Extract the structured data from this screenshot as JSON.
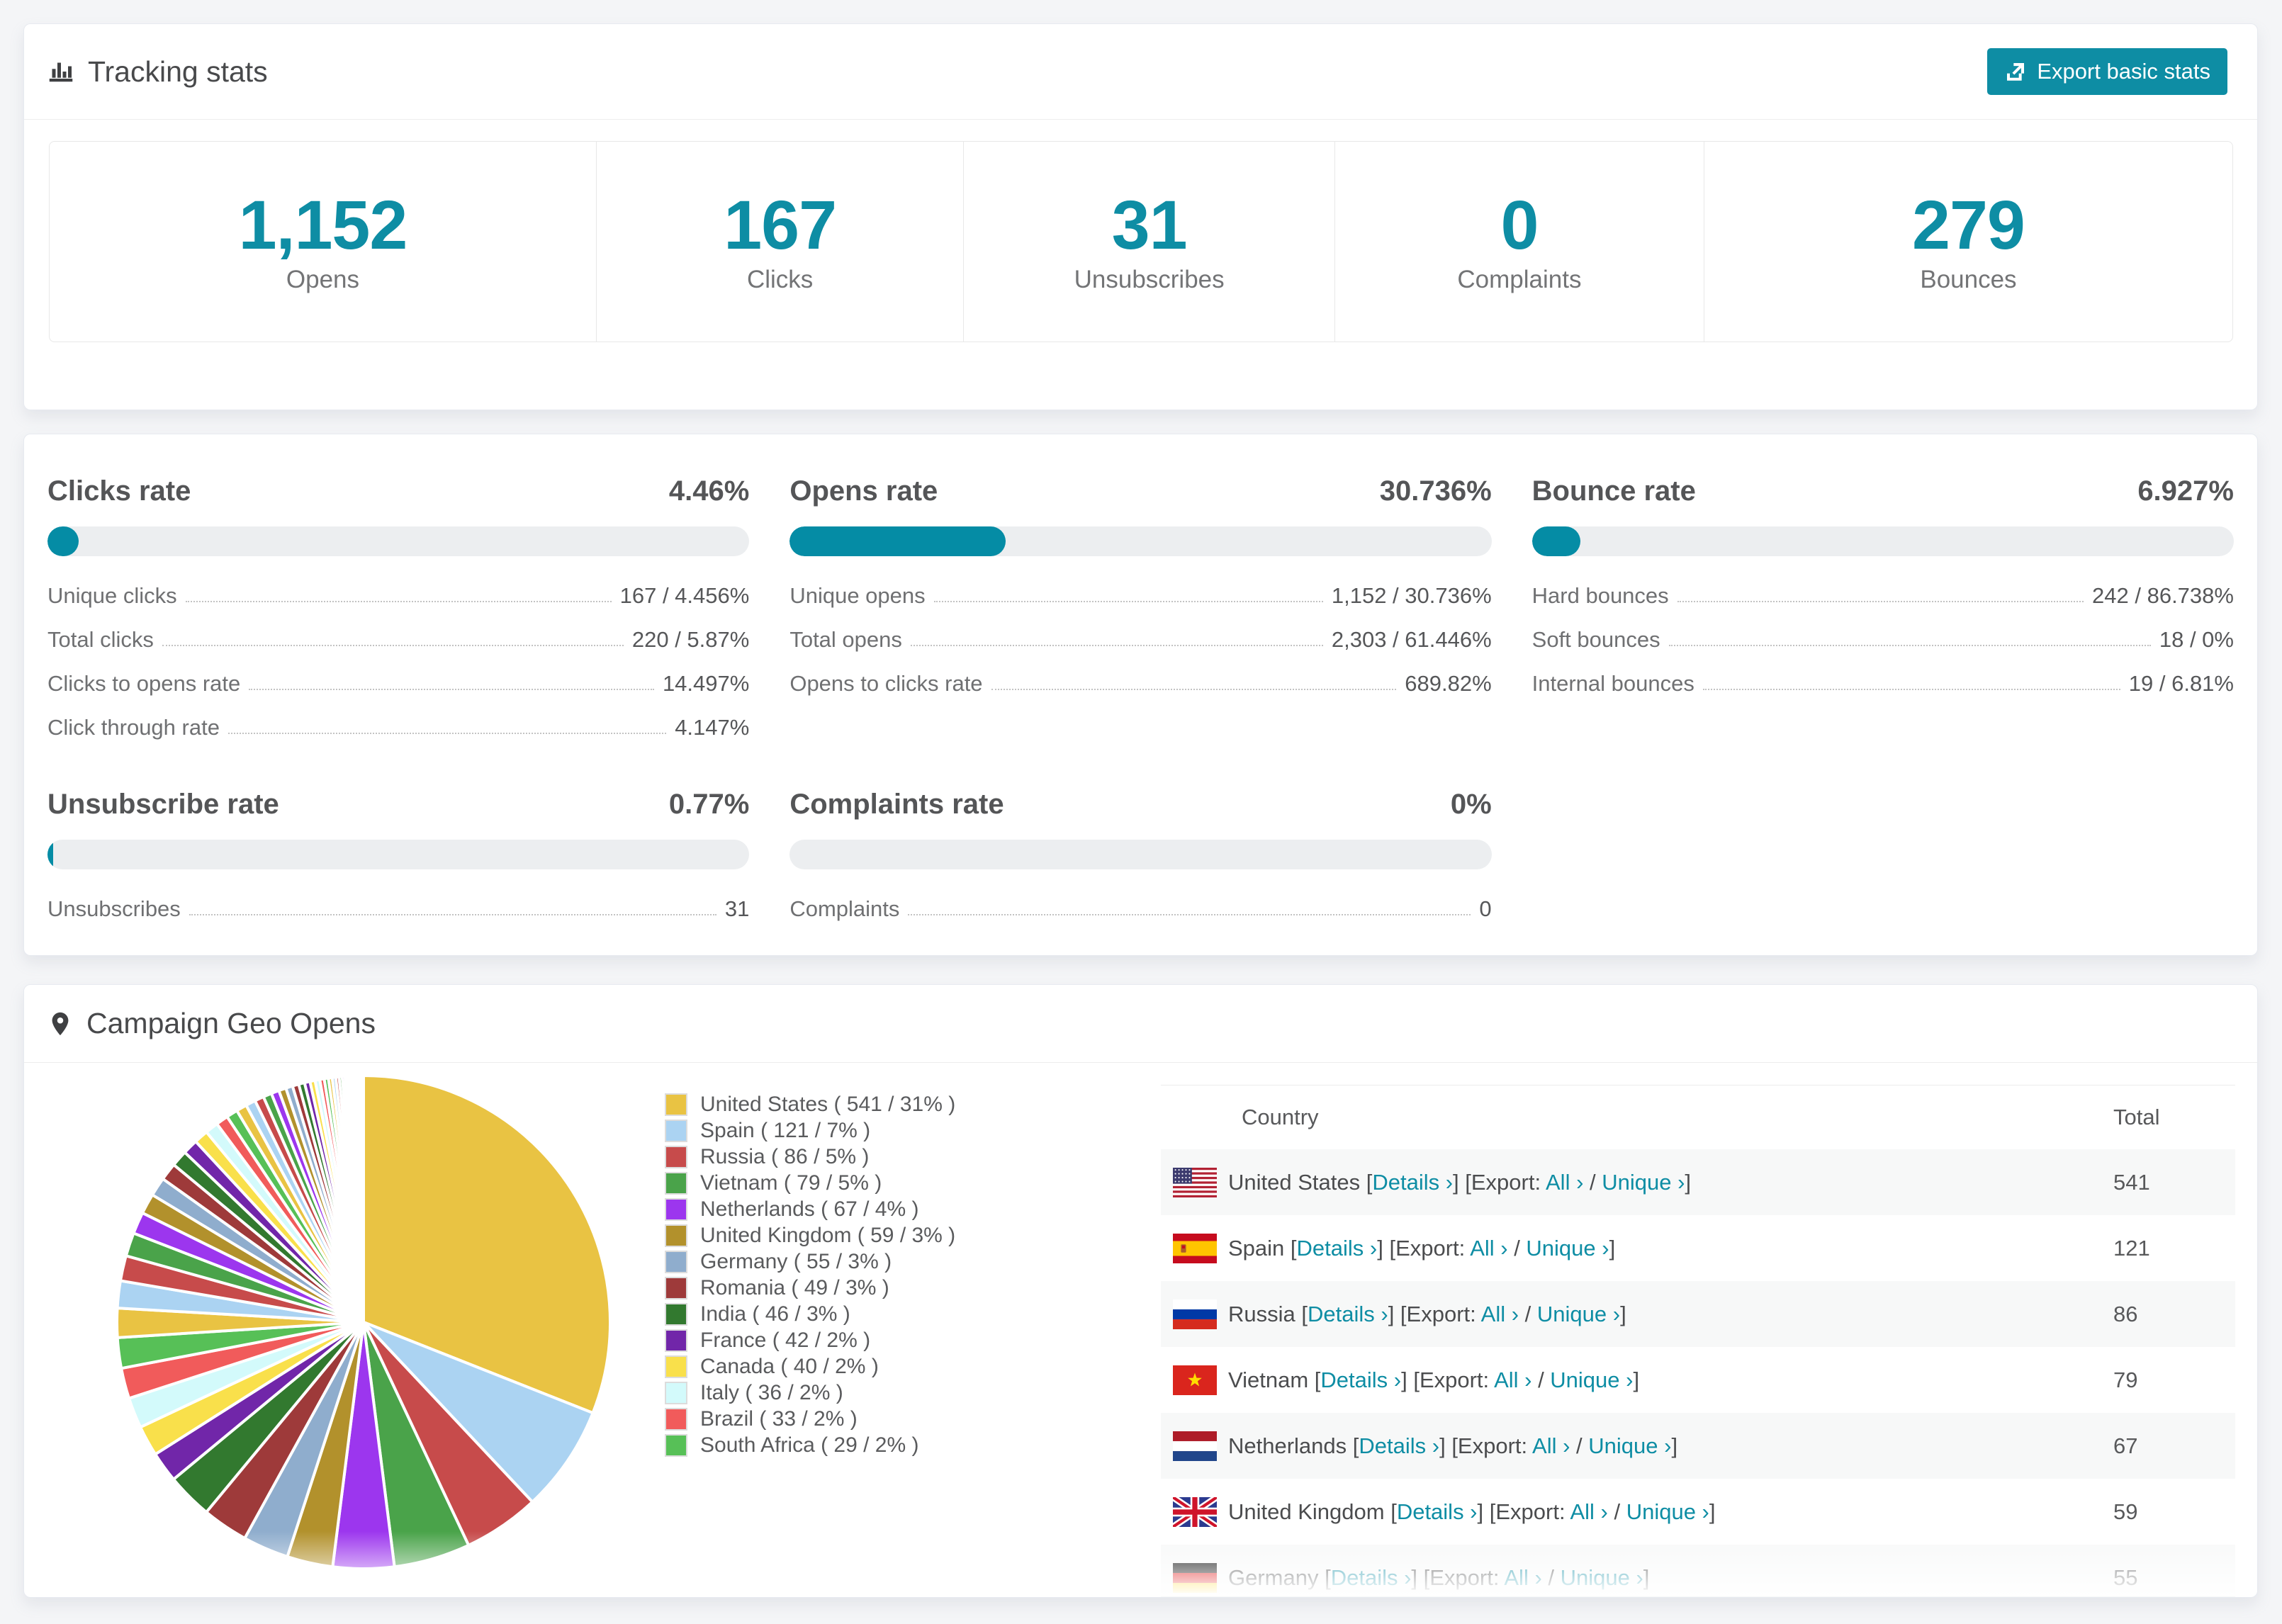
{
  "page": {
    "background": "#f4f5f7",
    "accent": "#0e8da4"
  },
  "tracking_card": {
    "title": "Tracking stats",
    "title_icon": "bar-chart-icon",
    "export_button": {
      "label": "Export basic stats",
      "icon": "export-icon",
      "background": "#0e8da4"
    },
    "summary": [
      {
        "value": "1,152",
        "label": "Opens"
      },
      {
        "value": "167",
        "label": "Clicks"
      },
      {
        "value": "31",
        "label": "Unsubscribes"
      },
      {
        "value": "0",
        "label": "Complaints"
      },
      {
        "value": "279",
        "label": "Bounces"
      }
    ]
  },
  "rates_card": {
    "blocks": [
      {
        "title": "Clicks rate",
        "value": "4.46%",
        "bar_pct": 4.46,
        "rows": [
          {
            "label": "Unique clicks",
            "value": "167 / 4.456%"
          },
          {
            "label": "Total clicks",
            "value": "220 / 5.87%"
          },
          {
            "label": "Clicks to opens rate",
            "value": "14.497%"
          },
          {
            "label": "Click through rate",
            "value": "4.147%"
          }
        ]
      },
      {
        "title": "Opens rate",
        "value": "30.736%",
        "bar_pct": 30.736,
        "rows": [
          {
            "label": "Unique opens",
            "value": "1,152 / 30.736%"
          },
          {
            "label": "Total opens",
            "value": "2,303 / 61.446%"
          },
          {
            "label": "Opens to clicks rate",
            "value": "689.82%"
          }
        ]
      },
      {
        "title": "Bounce rate",
        "value": "6.927%",
        "bar_pct": 6.927,
        "rows": [
          {
            "label": "Hard bounces",
            "value": "242 / 86.738%"
          },
          {
            "label": "Soft bounces",
            "value": "18 / 0%"
          },
          {
            "label": "Internal bounces",
            "value": "19 / 6.81%"
          }
        ]
      },
      {
        "title": "Unsubscribe rate",
        "value": "0.77%",
        "bar_pct": 0.77,
        "rows": [
          {
            "label": "Unsubscribes",
            "value": "31"
          }
        ]
      },
      {
        "title": "Complaints rate",
        "value": "0%",
        "bar_pct": 0,
        "rows": [
          {
            "label": "Complaints",
            "value": "0"
          }
        ]
      }
    ]
  },
  "geo_card": {
    "title": "Campaign Geo Opens",
    "title_icon": "map-pin-icon",
    "table": {
      "columns": [
        "Country",
        "Total"
      ],
      "link_labels": {
        "details": "Details ›",
        "export": "Export:",
        "all": "All ›",
        "unique": "Unique ›"
      },
      "punctuation": {
        "open": " [",
        "close": "]",
        "slash": " / ",
        "space": " "
      },
      "rows": [
        {
          "country": "United States",
          "flag": "us",
          "total": "541"
        },
        {
          "country": "Spain",
          "flag": "es",
          "total": "121"
        },
        {
          "country": "Russia",
          "flag": "ru",
          "total": "86"
        },
        {
          "country": "Vietnam",
          "flag": "vn",
          "total": "79"
        },
        {
          "country": "Netherlands",
          "flag": "nl",
          "total": "67"
        },
        {
          "country": "United Kingdom",
          "flag": "gb",
          "total": "59"
        },
        {
          "country": "Germany",
          "flag": "de",
          "total": "55",
          "clipped": true
        }
      ]
    }
  },
  "chart_data": {
    "type": "pie",
    "title": "Campaign Geo Opens",
    "unit": "opens",
    "start_angle_deg": 0,
    "direction": "clockwise",
    "legend_position": "right",
    "slices": [
      {
        "label": "United States",
        "value": 541,
        "pct": 31,
        "color": "#e9c343"
      },
      {
        "label": "Spain",
        "value": 121,
        "pct": 7,
        "color": "#abd3f2"
      },
      {
        "label": "Russia",
        "value": 86,
        "pct": 5,
        "color": "#c74b4b"
      },
      {
        "label": "Vietnam",
        "value": 79,
        "pct": 5,
        "color": "#4aa34a"
      },
      {
        "label": "Netherlands",
        "value": 67,
        "pct": 4,
        "color": "#9c36ee"
      },
      {
        "label": "United Kingdom",
        "value": 59,
        "pct": 3,
        "color": "#b2912c"
      },
      {
        "label": "Germany",
        "value": 55,
        "pct": 3,
        "color": "#8fadcd"
      },
      {
        "label": "Romania",
        "value": 49,
        "pct": 3,
        "color": "#9e3a3a"
      },
      {
        "label": "India",
        "value": 46,
        "pct": 3,
        "color": "#32792f"
      },
      {
        "label": "France",
        "value": 42,
        "pct": 2,
        "color": "#7126a9"
      },
      {
        "label": "Canada",
        "value": 40,
        "pct": 2,
        "color": "#f9e04b"
      },
      {
        "label": "Italy",
        "value": 36,
        "pct": 2,
        "color": "#d3fafb"
      },
      {
        "label": "Brazil",
        "value": 33,
        "pct": 2,
        "color": "#f15b5b"
      },
      {
        "label": "South Africa",
        "value": 29,
        "pct": 2,
        "color": "#57c057"
      }
    ],
    "others": {
      "total_pct": 26,
      "approx_slice_count": 42
    }
  }
}
